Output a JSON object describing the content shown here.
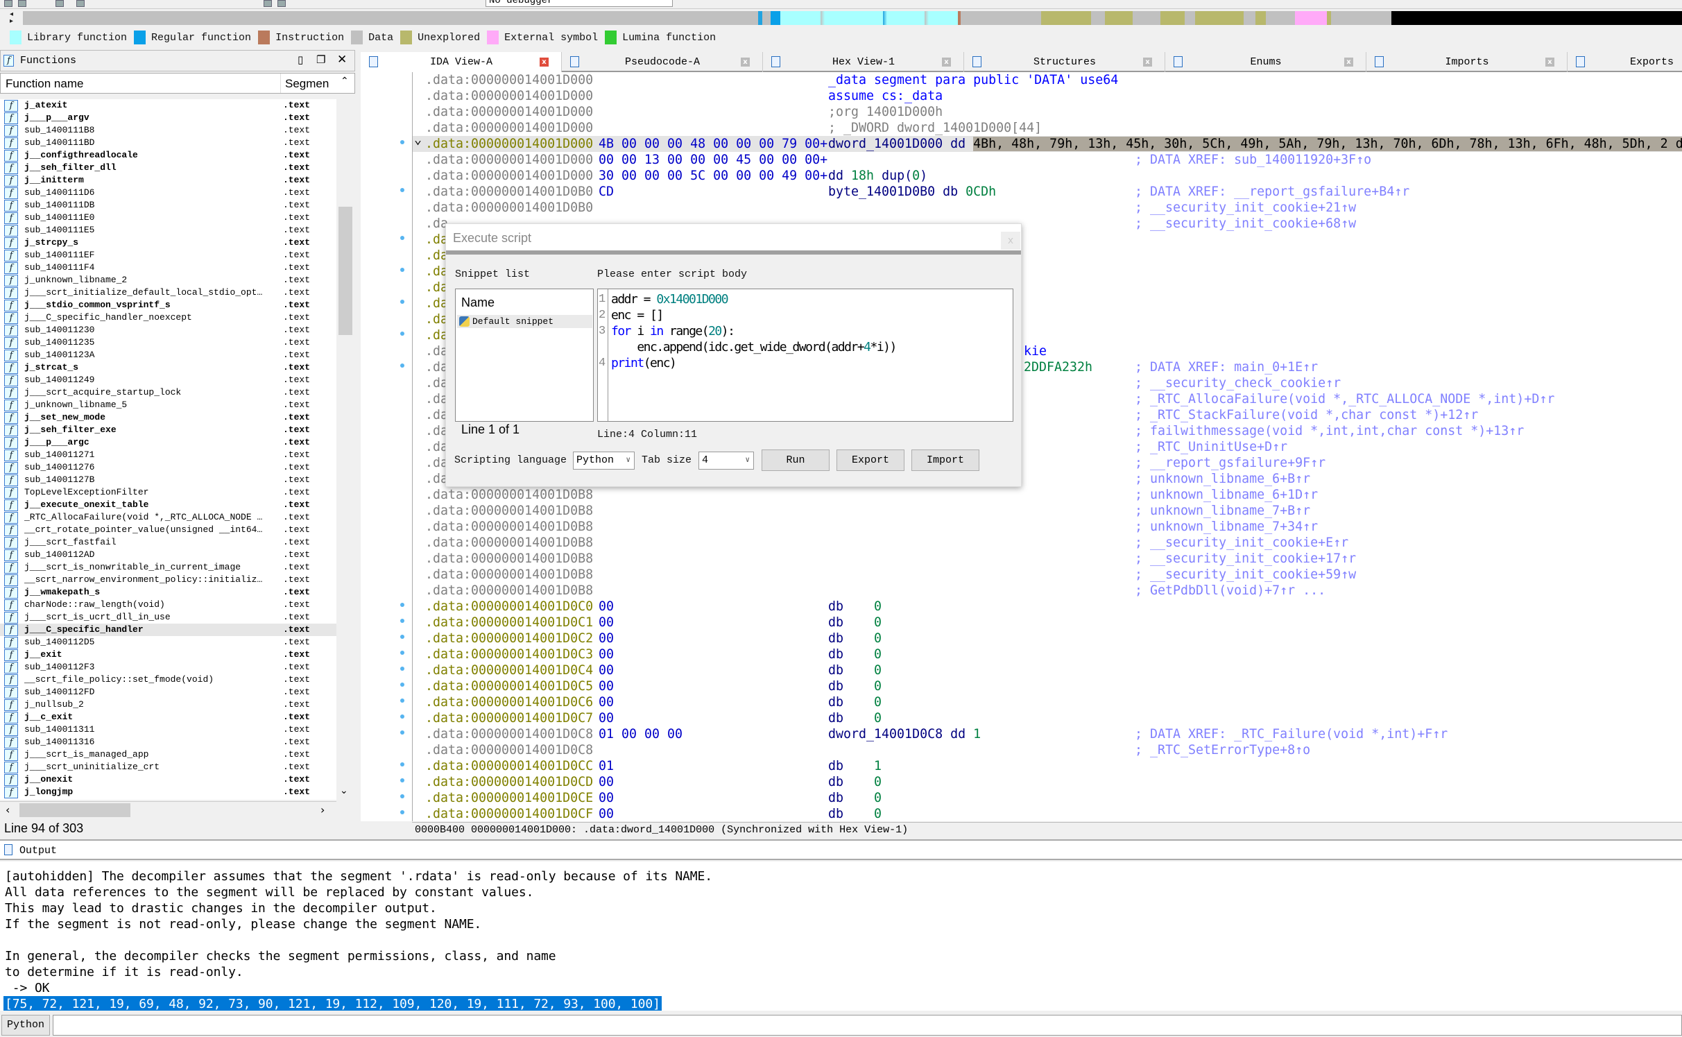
{
  "toolbar": {
    "debugger_select": "No debugger"
  },
  "legend": [
    {
      "label": "Library function",
      "color": "#a8ffff"
    },
    {
      "label": "Regular function",
      "color": "#0aa0e8"
    },
    {
      "label": "Instruction",
      "color": "#ba7a5c"
    },
    {
      "label": "Data",
      "color": "#c0c0c0"
    },
    {
      "label": "Unexplored",
      "color": "#b8b86c"
    },
    {
      "label": "External symbol",
      "color": "#ffaaf8"
    },
    {
      "label": "Lumina function",
      "color": "#33cc33"
    }
  ],
  "functions": {
    "title": "Functions",
    "col_name": "Function name",
    "col_segment": "Segmen",
    "status": "Line 94 of 303",
    "rows": [
      {
        "n": "j_atexit",
        "s": ".text",
        "b": 1
      },
      {
        "n": "j___p___argv",
        "s": ".text",
        "b": 1
      },
      {
        "n": "sub_1400111B8",
        "s": ".text"
      },
      {
        "n": "sub_1400111BD",
        "s": ".text"
      },
      {
        "n": "j__configthreadlocale",
        "s": ".text",
        "b": 1
      },
      {
        "n": "j__seh_filter_dll",
        "s": ".text",
        "b": 1
      },
      {
        "n": "j__initterm",
        "s": ".text",
        "b": 1
      },
      {
        "n": "sub_1400111D6",
        "s": ".text"
      },
      {
        "n": "sub_1400111DB",
        "s": ".text"
      },
      {
        "n": "sub_1400111E0",
        "s": ".text"
      },
      {
        "n": "sub_1400111E5",
        "s": ".text"
      },
      {
        "n": "j_strcpy_s",
        "s": ".text",
        "b": 1
      },
      {
        "n": "sub_1400111EF",
        "s": ".text"
      },
      {
        "n": "sub_1400111F4",
        "s": ".text"
      },
      {
        "n": "j_unknown_libname_2",
        "s": ".text"
      },
      {
        "n": "j___scrt_initialize_default_local_stdio_opt…",
        "s": ".text"
      },
      {
        "n": "j___stdio_common_vsprintf_s",
        "s": ".text",
        "b": 1
      },
      {
        "n": "j___C_specific_handler_noexcept",
        "s": ".text"
      },
      {
        "n": "sub_140011230",
        "s": ".text"
      },
      {
        "n": "sub_140011235",
        "s": ".text"
      },
      {
        "n": "sub_14001123A",
        "s": ".text"
      },
      {
        "n": "j_strcat_s",
        "s": ".text",
        "b": 1
      },
      {
        "n": "sub_140011249",
        "s": ".text"
      },
      {
        "n": "j___scrt_acquire_startup_lock",
        "s": ".text"
      },
      {
        "n": "j_unknown_libname_5",
        "s": ".text"
      },
      {
        "n": "j__set_new_mode",
        "s": ".text",
        "b": 1
      },
      {
        "n": "j__seh_filter_exe",
        "s": ".text",
        "b": 1
      },
      {
        "n": "j___p___argc",
        "s": ".text",
        "b": 1
      },
      {
        "n": "sub_140011271",
        "s": ".text"
      },
      {
        "n": "sub_140011276",
        "s": ".text"
      },
      {
        "n": "sub_14001127B",
        "s": ".text"
      },
      {
        "n": "TopLevelExceptionFilter",
        "s": ".text"
      },
      {
        "n": "j__execute_onexit_table",
        "s": ".text",
        "b": 1
      },
      {
        "n": "_RTC_AllocaFailure(void *,_RTC_ALLOCA_NODE …",
        "s": ".text"
      },
      {
        "n": "__crt_rotate_pointer_value(unsigned __int64…",
        "s": ".text"
      },
      {
        "n": "j___scrt_fastfail",
        "s": ".text"
      },
      {
        "n": "sub_1400112AD",
        "s": ".text"
      },
      {
        "n": "j___scrt_is_nonwritable_in_current_image",
        "s": ".text"
      },
      {
        "n": "__scrt_narrow_environment_policy::initializ…",
        "s": ".text"
      },
      {
        "n": "j__wmakepath_s",
        "s": ".text",
        "b": 1
      },
      {
        "n": "charNode::raw_length(void)",
        "s": ".text"
      },
      {
        "n": "j___scrt_is_ucrt_dll_in_use",
        "s": ".text"
      },
      {
        "n": "j___C_specific_handler",
        "s": ".text",
        "b": 1,
        "sel": 1
      },
      {
        "n": "sub_1400112D5",
        "s": ".text"
      },
      {
        "n": "j__exit",
        "s": ".text",
        "b": 1
      },
      {
        "n": "sub_1400112F3",
        "s": ".text"
      },
      {
        "n": "__scrt_file_policy::set_fmode(void)",
        "s": ".text"
      },
      {
        "n": "sub_1400112FD",
        "s": ".text"
      },
      {
        "n": "j_nullsub_2",
        "s": ".text"
      },
      {
        "n": "j__c_exit",
        "s": ".text",
        "b": 1
      },
      {
        "n": "sub_140011311",
        "s": ".text"
      },
      {
        "n": "sub_140011316",
        "s": ".text"
      },
      {
        "n": "j___scrt_is_managed_app",
        "s": ".text"
      },
      {
        "n": "j___scrt_uninitialize_crt",
        "s": ".text"
      },
      {
        "n": "j__onexit",
        "s": ".text",
        "b": 1
      },
      {
        "n": "j_longjmp",
        "s": ".text",
        "b": 1
      }
    ]
  },
  "tabs": [
    {
      "label": "IDA View-A",
      "active": true
    },
    {
      "label": "Pseudocode-A"
    },
    {
      "label": "Hex View-1"
    },
    {
      "label": "Structures"
    },
    {
      "label": "Enums"
    },
    {
      "label": "Imports"
    },
    {
      "label": "Exports"
    }
  ],
  "listing": {
    "status": "0000B400 000000014001D000: .data:dword_14001D000 (Synchronized with Hex View-1)",
    "lines": [
      {
        "a": ".data:000000014001D000",
        "i": [
          [
            "_data segment para public 'DATA' use64",
            "kw"
          ]
        ]
      },
      {
        "a": ".data:000000014001D000",
        "i": [
          [
            "assume cs:_data",
            "kw"
          ]
        ]
      },
      {
        "a": ".data:000000014001D000",
        "i": [
          [
            ";org 14001D000h",
            "cmg"
          ]
        ]
      },
      {
        "a": ".data:000000014001D000",
        "i": [
          [
            "; _DWORD dword_14001D000[44]",
            "cmg"
          ]
        ]
      },
      {
        "a": ".data:000000014001D000",
        "h": 1,
        "hl": 1,
        "bul": 1,
        "arrow": 1,
        "b": "4B 00 00 00 48 00 00 00 79 00+",
        "i": [
          [
            "dword_14001D000 dd ",
            "ins"
          ],
          [
            "4Bh, 48h, 79h, 13h, 45h, 30h, 5Ch, 49h, 5Ah, 79h, 13h, 70h, 6Dh, 78h, 13h, 6Fh, 48h, 5Dh, 2 d",
            "hl"
          ]
        ]
      },
      {
        "a": ".data:000000014001D000",
        "b": "00 00 13 00 00 00 45 00 00 00+",
        "c": "; DATA XREF: sub_140011920+3F↑o"
      },
      {
        "a": ".data:000000014001D000",
        "b": "30 00 00 00 5C 00 00 00 49 00+",
        "i": [
          [
            "dd ",
            "ins"
          ],
          [
            "18h",
            "num"
          ],
          [
            " dup(",
            "ins"
          ],
          [
            "0",
            "num"
          ],
          [
            ")",
            "ins"
          ]
        ]
      },
      {
        "a": ".data:000000014001D0B0",
        "bul": 1,
        "b": "CD",
        "i": [
          [
            "byte_14001D0B0 db ",
            "ins"
          ],
          [
            "0CDh",
            "num"
          ]
        ],
        "c": "; DATA XREF: __report_gsfailure+B4↑r"
      },
      {
        "a": ".data:000000014001D0B0",
        "c": "; __security_init_cookie+21↑w"
      },
      {
        "a": ".da",
        "c": "; __security_init_cookie+68↑w"
      },
      {
        "a": ".da",
        "h": 1,
        "bul": 1
      },
      {
        "a": ".da",
        "h": 1
      },
      {
        "a": ".da",
        "h": 1,
        "bul": 1
      },
      {
        "a": ".da",
        "h": 1
      },
      {
        "a": ".da",
        "h": 1,
        "bul": 1
      },
      {
        "a": ".da",
        "h": 1
      },
      {
        "a": ".da",
        "h": 1,
        "bul": 1
      },
      {
        "a": ".da",
        "t": [
          [
            "kie",
            "kw"
          ]
        ]
      },
      {
        "a": ".da",
        "bul": 1,
        "t": [
          [
            "2DDFA232h",
            "num"
          ]
        ],
        "c": "; DATA XREF: main_0+1E↑r"
      },
      {
        "a": ".da",
        "c": "; __security_check_cookie↑r"
      },
      {
        "a": ".da",
        "c": "; _RTC_AllocaFailure(void *,_RTC_ALLOCA_NODE *,int)+D↑r"
      },
      {
        "a": ".da",
        "c": "; _RTC_StackFailure(void *,char const *)+12↑r"
      },
      {
        "a": ".da",
        "c": "; failwithmessage(void *,int,int,char const *)+13↑r"
      },
      {
        "a": ".da",
        "c": "; _RTC_UninitUse+D↑r"
      },
      {
        "a": ".da",
        "c": "; __report_gsfailure+9F↑r"
      },
      {
        "a": ".data:000000014001D0B8",
        "c": "; unknown_libname_6+B↑r"
      },
      {
        "a": ".data:000000014001D0B8",
        "c": "; unknown_libname_6+1D↑r"
      },
      {
        "a": ".data:000000014001D0B8",
        "c": "; unknown_libname_7+B↑r"
      },
      {
        "a": ".data:000000014001D0B8",
        "c": "; unknown_libname_7+34↑r"
      },
      {
        "a": ".data:000000014001D0B8",
        "c": "; __security_init_cookie+E↑r"
      },
      {
        "a": ".data:000000014001D0B8",
        "c": "; __security_init_cookie+17↑r"
      },
      {
        "a": ".data:000000014001D0B8",
        "c": "; __security_init_cookie+59↑w"
      },
      {
        "a": ".data:000000014001D0B8",
        "c": "; GetPdbDll(void)+7↑r ..."
      },
      {
        "a": ".data:000000014001D0C0",
        "h": 1,
        "bul": 1,
        "b": "00",
        "i": [
          [
            "db    ",
            "ins"
          ],
          [
            "0",
            "num"
          ]
        ]
      },
      {
        "a": ".data:000000014001D0C1",
        "h": 1,
        "bul": 1,
        "b": "00",
        "i": [
          [
            "db    ",
            "ins"
          ],
          [
            "0",
            "num"
          ]
        ]
      },
      {
        "a": ".data:000000014001D0C2",
        "h": 1,
        "bul": 1,
        "b": "00",
        "i": [
          [
            "db    ",
            "ins"
          ],
          [
            "0",
            "num"
          ]
        ]
      },
      {
        "a": ".data:000000014001D0C3",
        "h": 1,
        "bul": 1,
        "b": "00",
        "i": [
          [
            "db    ",
            "ins"
          ],
          [
            "0",
            "num"
          ]
        ]
      },
      {
        "a": ".data:000000014001D0C4",
        "h": 1,
        "bul": 1,
        "b": "00",
        "i": [
          [
            "db    ",
            "ins"
          ],
          [
            "0",
            "num"
          ]
        ]
      },
      {
        "a": ".data:000000014001D0C5",
        "h": 1,
        "bul": 1,
        "b": "00",
        "i": [
          [
            "db    ",
            "ins"
          ],
          [
            "0",
            "num"
          ]
        ]
      },
      {
        "a": ".data:000000014001D0C6",
        "h": 1,
        "bul": 1,
        "b": "00",
        "i": [
          [
            "db    ",
            "ins"
          ],
          [
            "0",
            "num"
          ]
        ]
      },
      {
        "a": ".data:000000014001D0C7",
        "h": 1,
        "bul": 1,
        "b": "00",
        "i": [
          [
            "db    ",
            "ins"
          ],
          [
            "0",
            "num"
          ]
        ]
      },
      {
        "a": ".data:000000014001D0C8",
        "bul": 1,
        "b": "01 00 00 00",
        "i": [
          [
            "dword_14001D0C8 dd ",
            "ins"
          ],
          [
            "1",
            "num"
          ]
        ],
        "c": "; DATA XREF: _RTC_Failure(void *,int)+F↑r"
      },
      {
        "a": ".data:000000014001D0C8",
        "c": "; _RTC_SetErrorType+8↑o"
      },
      {
        "a": ".data:000000014001D0CC",
        "h": 1,
        "bul": 1,
        "b": "01",
        "i": [
          [
            "db    ",
            "ins"
          ],
          [
            "1",
            "num"
          ]
        ]
      },
      {
        "a": ".data:000000014001D0CD",
        "h": 1,
        "bul": 1,
        "b": "00",
        "i": [
          [
            "db    ",
            "ins"
          ],
          [
            "0",
            "num"
          ]
        ]
      },
      {
        "a": ".data:000000014001D0CE",
        "h": 1,
        "bul": 1,
        "b": "00",
        "i": [
          [
            "db    ",
            "ins"
          ],
          [
            "0",
            "num"
          ]
        ]
      },
      {
        "a": ".data:000000014001D0CF",
        "h": 1,
        "bul": 1,
        "b": "00",
        "i": [
          [
            "db    ",
            "ins"
          ],
          [
            "0",
            "num"
          ]
        ]
      }
    ]
  },
  "dialog": {
    "title": "Execute script",
    "close": "x",
    "snippet_label": "Snippet list",
    "snippet_col": "Name",
    "snippet_item": "Default snippet",
    "snippet_status": "Line 1 of 1",
    "body_label": "Please enter script body",
    "code_lines": [
      {
        "num": "1",
        "tokens": [
          [
            "addr = ",
            ""
          ],
          [
            "0x14001D000",
            "n"
          ]
        ]
      },
      {
        "num": "2",
        "tokens": [
          [
            "enc = []",
            ""
          ]
        ]
      },
      {
        "num": "3",
        "tokens": [
          [
            "for",
            "k"
          ],
          [
            " i ",
            ""
          ],
          [
            "in",
            "k"
          ],
          [
            " range(",
            ""
          ],
          [
            "20",
            "n"
          ],
          [
            "):",
            ""
          ]
        ]
      },
      {
        "num": "",
        "tokens": [
          [
            "    enc.append(idc.get_wide_dword(addr+",
            ""
          ],
          [
            "4",
            "n"
          ],
          [
            "*i))",
            ""
          ]
        ]
      },
      {
        "num": "4",
        "tokens": [
          [
            "print",
            "k"
          ],
          [
            "(enc)",
            ""
          ]
        ]
      }
    ],
    "cursor_status": "Line:4  Column:11",
    "lang_label": "Scripting language",
    "lang_value": "Python",
    "tab_label": "Tab size",
    "tab_value": "4",
    "run": "Run",
    "export": "Export",
    "import": "Import"
  },
  "output": {
    "title": "Output",
    "lines": [
      "[autohidden] The decompiler assumes that the segment '.rdata' is read-only because of its NAME.",
      "All data references to the segment will be replaced by constant values.",
      "This may lead to drastic changes in the decompiler output.",
      "If the segment is not read-only, please change the segment NAME.",
      "",
      "In general, the decompiler checks the segment permissions, class, and name",
      "to determine if it is read-only.",
      " -> OK"
    ],
    "result": "[75, 72, 121, 19, 69, 48, 92, 73, 90, 121, 19, 112, 109, 120, 19, 111, 72, 93, 100, 100]",
    "cli_button": "Python"
  }
}
